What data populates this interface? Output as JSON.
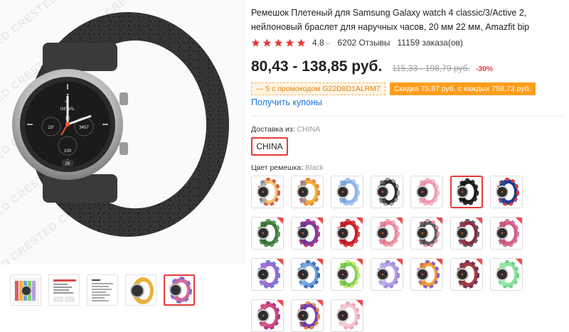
{
  "product": {
    "title": "Ремешок Плетеный для Samsung Galaxy watch 4 classic/3/Active 2, нейлоновый браслет для наручных часов, 20 мм 22 мм, Amazfit bip",
    "watermark": "CRESTED",
    "watch_face": {
      "brand_letter": "J",
      "brand_text": "INITIAL",
      "num_top": "12",
      "num_left": "23°",
      "num_right": "3457",
      "num_bottom": "100",
      "date": "28"
    }
  },
  "rating": {
    "stars": 5,
    "value": "4.8",
    "reviews": "6202 Отзывы",
    "orders": "11159 заказа(ов)"
  },
  "price": {
    "range": "80,43 - 138,85 руб.",
    "old_range": "115,33 - 198,79 руб.",
    "discount": "-30%"
  },
  "promo": {
    "code_text": "— 5 с промокодом G22D8D1ALRM7",
    "discount_text": "Скидка 75,87 руб. с каждых 758,73 руб."
  },
  "coupons_link": "Получить купоны",
  "shipping": {
    "label": "Доставка из:",
    "value": "CHINA",
    "option": "CHINA"
  },
  "color": {
    "label": "Цвет ремешка:",
    "value": "Black"
  },
  "colors": {
    "accent": "#e63a3a",
    "link": "#1a72d8",
    "promo_orange": "#ff9d1c"
  },
  "swatches": [
    {
      "c1": "#f2c26a",
      "c2": "#d9534f",
      "c3": "#6aa5d8",
      "tag": false,
      "selected": false
    },
    {
      "c1": "#f0b03c",
      "c2": "#e9873a",
      "c3": "#7d6bd0",
      "tag": false,
      "selected": false
    },
    {
      "c1": "#8fb3e6",
      "c2": "#a9c6ef",
      "c3": "#6d93cf",
      "tag": false,
      "selected": false
    },
    {
      "c1": "#2a2a2a",
      "c2": "#9a9a9a",
      "c3": "#555555",
      "tag": false,
      "selected": false
    },
    {
      "c1": "#f29bb0",
      "c2": "#f6b8c6",
      "c3": "#e88aa2",
      "tag": false,
      "selected": false
    },
    {
      "c1": "#1d1d1d",
      "c2": "#2c2c2c",
      "c3": "#111111",
      "tag": false,
      "selected": true
    },
    {
      "c1": "#1d3c8f",
      "c2": "#d63b3b",
      "c3": "#254aa8",
      "tag": false,
      "selected": false
    },
    {
      "c1": "#3f7a3f",
      "c2": "#5a955a",
      "c3": "#2f662f",
      "tag": true,
      "selected": false
    },
    {
      "c1": "#7b3aa0",
      "c2": "#b63a7f",
      "c3": "#5c2d87",
      "tag": true,
      "selected": false
    },
    {
      "c1": "#c8202a",
      "c2": "#e03c3c",
      "c3": "#a3151e",
      "tag": true,
      "selected": false
    },
    {
      "c1": "#e8899b",
      "c2": "#f2a7b5",
      "c3": "#d97085",
      "tag": true,
      "selected": false
    },
    {
      "c1": "#5d5d5d",
      "c2": "#e58fa6",
      "c3": "#3d3d3d",
      "tag": true,
      "selected": false
    },
    {
      "c1": "#8a2d3f",
      "c2": "#5b5b5b",
      "c3": "#a13a4d",
      "tag": true,
      "selected": false
    },
    {
      "c1": "#d85a7f",
      "c2": "#c87aa8",
      "c3": "#b84c6e",
      "tag": true,
      "selected": false
    },
    {
      "c1": "#9c6bd0",
      "c2": "#6a7de0",
      "c3": "#b07ad6",
      "tag": true,
      "selected": false
    },
    {
      "c1": "#6fa0d8",
      "c2": "#3a6db5",
      "c3": "#8bb5e3",
      "tag": true,
      "selected": false
    },
    {
      "c1": "#7fcf5b",
      "c2": "#c9e86a",
      "c3": "#5fb640",
      "tag": true,
      "selected": false
    },
    {
      "c1": "#b49ee6",
      "c2": "#9e8ad8",
      "c3": "#c8b6ef",
      "tag": true,
      "selected": false
    },
    {
      "c1": "#f0a037",
      "c2": "#8a5dc7",
      "c3": "#e88a2a",
      "tag": true,
      "selected": false
    },
    {
      "c1": "#a54040",
      "c2": "#6e2d5a",
      "c3": "#8a3a3a",
      "tag": true,
      "selected": false
    },
    {
      "c1": "#8fe3a2",
      "c2": "#6fd48a",
      "c3": "#a6ecb5",
      "tag": true,
      "selected": false
    },
    {
      "c1": "#d24a7a",
      "c2": "#a13a8f",
      "c3": "#e0608a",
      "tag": true,
      "selected": false
    },
    {
      "c1": "#7a44b8",
      "c2": "#e08a3a",
      "c3": "#5d3199",
      "tag": true,
      "selected": false
    },
    {
      "c1": "#f2c6cf",
      "c2": "#eaa8b6",
      "c3": "#f6d6dc",
      "tag": true,
      "selected": false
    }
  ],
  "thumbnails": [
    {
      "name": "thumb-bands-collage",
      "selected": false
    },
    {
      "name": "thumb-size-chart",
      "selected": false
    },
    {
      "name": "thumb-spec-sheet",
      "selected": false
    },
    {
      "name": "thumb-yellow-band",
      "selected": false
    },
    {
      "name": "thumb-rainbow-band",
      "selected": true
    }
  ]
}
